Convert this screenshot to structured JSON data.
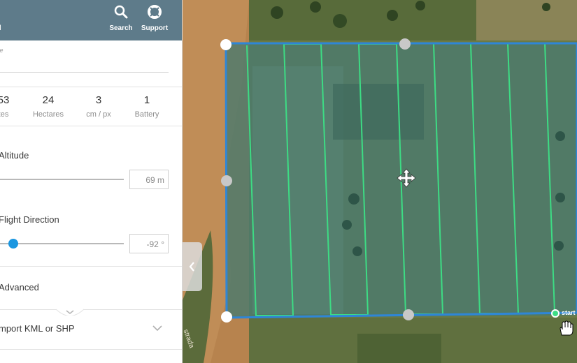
{
  "topbar": {
    "dashboard_label": "ard",
    "search_label": "Search",
    "support_label": "Support"
  },
  "form": {
    "name_label": "me"
  },
  "stats": [
    {
      "value": "53",
      "unit": "tes"
    },
    {
      "value": "24",
      "unit": "Hectares"
    },
    {
      "value": "3",
      "unit": "cm / px"
    },
    {
      "value": "1",
      "unit": "Battery"
    }
  ],
  "altitude": {
    "label": "Altitude",
    "value": "69 m"
  },
  "flight_direction": {
    "label": "Flight Direction",
    "value": "-92 °"
  },
  "advanced": {
    "label": "Advanced"
  },
  "import": {
    "label": "mport KML or SHP"
  },
  "map": {
    "start_label": "start",
    "road_label": "strada",
    "colors": {
      "boundary": "#2f86d6",
      "flight_lines": "#3ddc84",
      "handle": "#ffffff",
      "mid_handle": "#c8c8c8",
      "slider_accent": "#1a96e0",
      "topbar": "#5e7b8a"
    }
  }
}
